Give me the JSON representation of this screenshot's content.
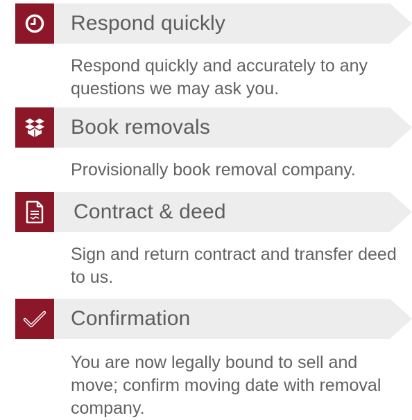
{
  "colors": {
    "accent": "#8b1728",
    "title_bar": "#ededed",
    "text": "#5d5d5d"
  },
  "steps": [
    {
      "icon": "clock-icon",
      "title": "Respond quickly",
      "description": "Respond quickly and accurately to any questions we may ask you."
    },
    {
      "icon": "boxes-icon",
      "title": "Book removals",
      "description": "Provisionally book removal company."
    },
    {
      "icon": "document-icon",
      "title": "Contract & deed",
      "description": "Sign and return contract and transfer deed to us."
    },
    {
      "icon": "checkmark-icon",
      "title": "Confirmation",
      "description": "You are now legally bound to sell and move; confirm moving date with removal company."
    }
  ]
}
